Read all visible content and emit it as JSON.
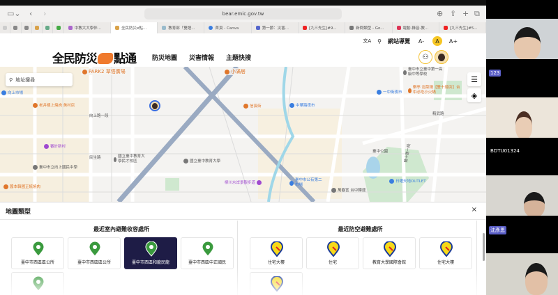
{
  "browser": {
    "url": "bear.emic.gov.tw",
    "tabs": [
      {
        "label": "中教大大學伴..."
      },
      {
        "label": "全民防災e點...",
        "active": true
      },
      {
        "label": "教育部「雙語..."
      },
      {
        "label": "首頁 - Canva"
      },
      {
        "label": "第一節：災害..."
      },
      {
        "label": "[九三先生]#9..."
      },
      {
        "label": "新問類型 - Go..."
      },
      {
        "label": "電動-錄音-教..."
      },
      {
        "label": "[九三先生]#5..."
      }
    ]
  },
  "header": {
    "logo": "全民防災e點通",
    "logo_left": "全民防災",
    "logo_right": "點通",
    "site_nav": "網站導覽",
    "font_sizes": [
      "A-",
      "A",
      "A+"
    ],
    "nav": [
      "防災地圖",
      "災害情報",
      "主題快搜"
    ]
  },
  "map": {
    "search_placeholder": "地址搜尋",
    "labels": [
      "向上市場",
      "老井極上燒肉 美村店",
      "審計新村",
      "國立臺中教育大學",
      "國立臺中教育大學民才校區",
      "臺中市立向上國民中學",
      "醬本韓國正統燒肉",
      "PARK2 草悟廣場",
      "小滿居",
      "信長街",
      "中華路夜市",
      "一中街夜市",
      "臺中市立臺中第一高級中等學校",
      "柳川水岸景觀步道",
      "臺中市公有第二市場",
      "萬春宮 台中轉運",
      "日曜天地OUTLET",
      "臺中公園",
      "向上路一段",
      "民生路",
      "精武路",
      "雙十路一段",
      "樂亭 泡菜鍋【雙十總店】台中必吃小火鍋"
    ]
  },
  "panel": {
    "title": "地圖類型",
    "close": "×",
    "indoor": {
      "title": "最近室內避難收容處所",
      "items": [
        {
          "label": "臺中市西區區公所"
        },
        {
          "label": "臺中市西區區公所"
        },
        {
          "label": "臺中市西區和龍民龍",
          "selected": true
        },
        {
          "label": "臺中市西區中正國民"
        },
        {
          "label": ""
        }
      ]
    },
    "air_raid": {
      "title": "最近防空避難處所",
      "items": [
        {
          "label": "住宅大樓"
        },
        {
          "label": "住宅"
        },
        {
          "label": "教育大學國際會館"
        },
        {
          "label": "住宅大樓"
        },
        {
          "label": ""
        }
      ]
    }
  },
  "videos": [
    {
      "name": ""
    },
    {
      "name": "123"
    },
    {
      "name": "BDTU01324"
    },
    {
      "name": "沈彥恩"
    }
  ],
  "colors": {
    "accent": "#f07a2d",
    "shelter_green": "#3a9a3e",
    "air_raid_yellow": "#f6d919",
    "selected": "#1e1c46"
  }
}
